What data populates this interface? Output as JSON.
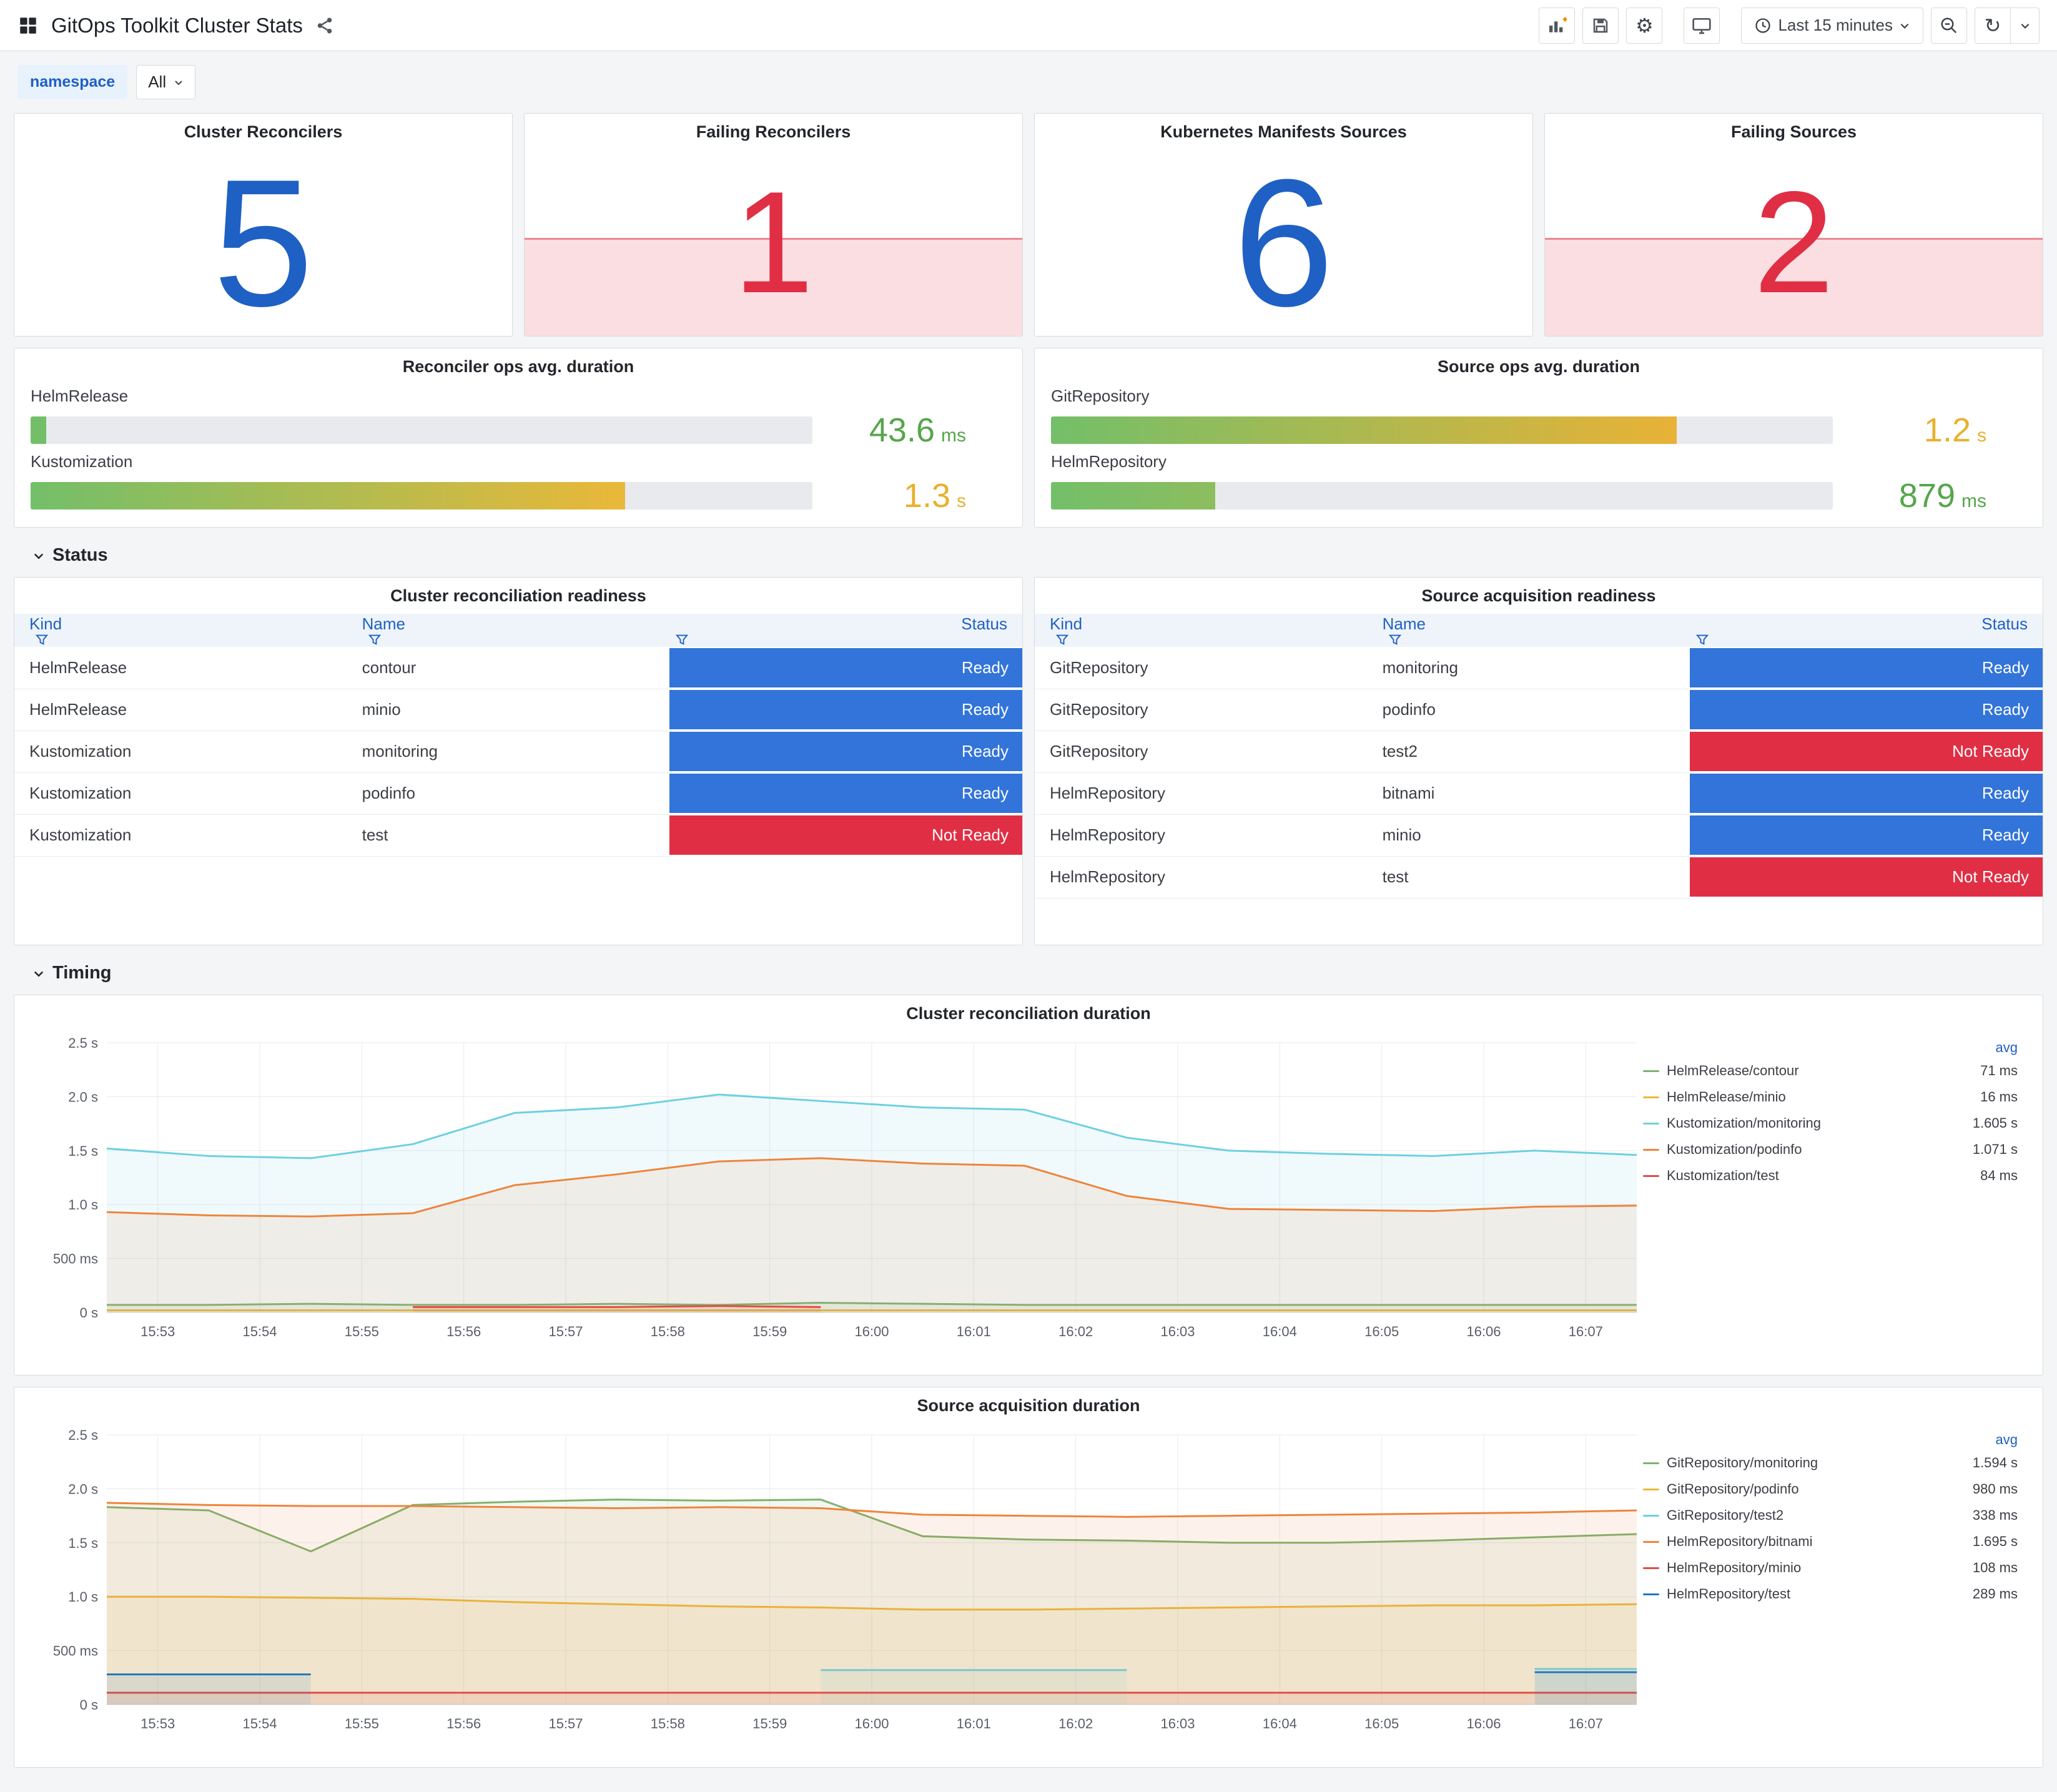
{
  "toolbar": {
    "title": "GitOps Toolkit Cluster Stats",
    "time_range": "Last 15 minutes"
  },
  "icons": {
    "gear": "⚙",
    "refresh": "↻"
  },
  "variables": {
    "namespace_label": "namespace",
    "namespace_value": "All"
  },
  "sections": {
    "status": "Status",
    "timing": "Timing"
  },
  "colors": {
    "blue": "#1F60C4",
    "red": "#E02F44",
    "ready": "#3274D9",
    "not_ready": "#E02F44",
    "alert_band": "rgba(224,47,68,0.16)",
    "alert_line": "rgba(224,47,68,0.5)"
  },
  "stat_panels": [
    {
      "title": "Cluster Reconcilers",
      "value": "5",
      "state": "ok"
    },
    {
      "title": "Failing Reconcilers",
      "value": "1",
      "state": "alert"
    },
    {
      "title": "Kubernetes Manifests Sources",
      "value": "6",
      "state": "ok"
    },
    {
      "title": "Failing Sources",
      "value": "2",
      "state": "alert"
    }
  ],
  "gauge_panels": [
    {
      "title": "Reconciler ops avg. duration",
      "rows": [
        {
          "label": "HelmRelease",
          "value": "43.6",
          "unit": "ms",
          "pct": 2,
          "value_color": "#56A64B",
          "bar_from": "#73BF69",
          "bar_to": "#73BF69"
        },
        {
          "label": "Kustomization",
          "value": "1.3",
          "unit": "s",
          "pct": 76,
          "value_color": "#E8B12E",
          "bar_from": "#73BF69",
          "bar_to": "#EAB839"
        }
      ]
    },
    {
      "title": "Source ops avg. duration",
      "rows": [
        {
          "label": "GitRepository",
          "value": "1.2",
          "unit": "s",
          "pct": 80,
          "value_color": "#E8B12E",
          "bar_from": "#73BF69",
          "bar_to": "#E8B236"
        },
        {
          "label": "HelmRepository",
          "value": "879",
          "unit": "ms",
          "pct": 21,
          "value_color": "#56A64B",
          "bar_from": "#73BF69",
          "bar_to": "#8CBE5F"
        }
      ]
    }
  ],
  "table_panels": [
    {
      "title": "Cluster reconciliation readiness",
      "columns": [
        "Kind",
        "Name",
        "Status"
      ],
      "rows": [
        [
          "HelmRelease",
          "contour",
          "Ready"
        ],
        [
          "HelmRelease",
          "minio",
          "Ready"
        ],
        [
          "Kustomization",
          "monitoring",
          "Ready"
        ],
        [
          "Kustomization",
          "podinfo",
          "Ready"
        ],
        [
          "Kustomization",
          "test",
          "Not Ready"
        ]
      ]
    },
    {
      "title": "Source acquisition readiness",
      "columns": [
        "Kind",
        "Name",
        "Status"
      ],
      "rows": [
        [
          "GitRepository",
          "monitoring",
          "Ready"
        ],
        [
          "GitRepository",
          "podinfo",
          "Ready"
        ],
        [
          "GitRepository",
          "test2",
          "Not Ready"
        ],
        [
          "HelmRepository",
          "bitnami",
          "Ready"
        ],
        [
          "HelmRepository",
          "minio",
          "Ready"
        ],
        [
          "HelmRepository",
          "test",
          "Not Ready"
        ]
      ]
    }
  ],
  "chart_data": [
    {
      "type": "line",
      "title": "Cluster reconciliation duration",
      "ylim": [
        0,
        2.5
      ],
      "yticks": [
        {
          "v": 0,
          "label": "0 s"
        },
        {
          "v": 0.5,
          "label": "500 ms"
        },
        {
          "v": 1,
          "label": "1.0 s"
        },
        {
          "v": 1.5,
          "label": "1.5 s"
        },
        {
          "v": 2,
          "label": "2.0 s"
        },
        {
          "v": 2.5,
          "label": "2.5 s"
        }
      ],
      "x_domain": [
        0,
        15
      ],
      "tick_start": 0.5,
      "xticks": [
        "15:53",
        "15:54",
        "15:55",
        "15:56",
        "15:57",
        "15:58",
        "15:59",
        "16:00",
        "16:01",
        "16:02",
        "16:03",
        "16:04",
        "16:05",
        "16:06",
        "16:07"
      ],
      "legend_header": "avg",
      "series": [
        {
          "name": "HelmRelease/contour",
          "avg": "71 ms",
          "color": "#7EB26D",
          "values": [
            0.07,
            0.07,
            0.08,
            0.07,
            0.07,
            0.08,
            0.07,
            0.09,
            0.08,
            0.07,
            0.07,
            0.07,
            0.07,
            0.07,
            0.07,
            0.07
          ]
        },
        {
          "name": "HelmRelease/minio",
          "avg": "16 ms",
          "color": "#EAB839",
          "values": [
            0.02,
            0.02,
            0.02,
            0.02,
            0.02,
            0.02,
            0.02,
            0.02,
            0.02,
            0.02,
            0.02,
            0.02,
            0.02,
            0.02,
            0.02,
            0.02
          ]
        },
        {
          "name": "Kustomization/monitoring",
          "avg": "1.605 s",
          "color": "#6ED0E0",
          "values": [
            1.52,
            1.45,
            1.43,
            1.56,
            1.85,
            1.9,
            2.02,
            1.96,
            1.9,
            1.88,
            1.62,
            1.5,
            1.47,
            1.45,
            1.5,
            1.46
          ]
        },
        {
          "name": "Kustomization/podinfo",
          "avg": "1.071 s",
          "color": "#EF843C",
          "values": [
            0.93,
            0.9,
            0.89,
            0.92,
            1.18,
            1.28,
            1.4,
            1.43,
            1.38,
            1.36,
            1.08,
            0.96,
            0.95,
            0.94,
            0.98,
            0.99
          ]
        },
        {
          "name": "Kustomization/test",
          "avg": "84 ms",
          "color": "#E24D42",
          "values": [
            null,
            null,
            null,
            0.05,
            0.05,
            0.05,
            0.06,
            0.05,
            null,
            null,
            null,
            null,
            null,
            null,
            null,
            null
          ]
        }
      ]
    },
    {
      "type": "line",
      "title": "Source acquisition duration",
      "ylim": [
        0,
        2.5
      ],
      "yticks": [
        {
          "v": 0,
          "label": "0 s"
        },
        {
          "v": 0.5,
          "label": "500 ms"
        },
        {
          "v": 1,
          "label": "1.0 s"
        },
        {
          "v": 1.5,
          "label": "1.5 s"
        },
        {
          "v": 2,
          "label": "2.0 s"
        },
        {
          "v": 2.5,
          "label": "2.5 s"
        }
      ],
      "x_domain": [
        0,
        15
      ],
      "tick_start": 0.5,
      "xticks": [
        "15:53",
        "15:54",
        "15:55",
        "15:56",
        "15:57",
        "15:58",
        "15:59",
        "16:00",
        "16:01",
        "16:02",
        "16:03",
        "16:04",
        "16:05",
        "16:06",
        "16:07"
      ],
      "legend_header": "avg",
      "series": [
        {
          "name": "GitRepository/monitoring",
          "avg": "1.594 s",
          "color": "#7EB26D",
          "values": [
            1.83,
            1.8,
            1.42,
            1.85,
            1.88,
            1.9,
            1.89,
            1.9,
            1.56,
            1.53,
            1.52,
            1.5,
            1.5,
            1.52,
            1.55,
            1.58
          ]
        },
        {
          "name": "GitRepository/podinfo",
          "avg": "980 ms",
          "color": "#EAB839",
          "values": [
            1.0,
            1.0,
            0.99,
            0.98,
            0.95,
            0.93,
            0.91,
            0.9,
            0.88,
            0.88,
            0.89,
            0.9,
            0.91,
            0.92,
            0.92,
            0.93
          ]
        },
        {
          "name": "GitRepository/test2",
          "avg": "338 ms",
          "color": "#6ED0E0",
          "values": [
            null,
            null,
            null,
            null,
            null,
            null,
            null,
            0.32,
            0.32,
            0.32,
            0.32,
            null,
            null,
            null,
            0.33,
            0.33
          ]
        },
        {
          "name": "HelmRepository/bitnami",
          "avg": "1.695 s",
          "color": "#EF843C",
          "values": [
            1.87,
            1.85,
            1.84,
            1.84,
            1.83,
            1.82,
            1.83,
            1.82,
            1.76,
            1.75,
            1.74,
            1.75,
            1.76,
            1.77,
            1.78,
            1.8
          ]
        },
        {
          "name": "HelmRepository/minio",
          "avg": "108 ms",
          "color": "#E24D42",
          "values": [
            0.11,
            0.11,
            0.11,
            0.11,
            0.11,
            0.11,
            0.11,
            0.11,
            0.11,
            0.11,
            0.11,
            0.11,
            0.11,
            0.11,
            0.11,
            0.11
          ]
        },
        {
          "name": "HelmRepository/test",
          "avg": "289 ms",
          "color": "#1F78C1",
          "values": [
            0.28,
            0.28,
            0.28,
            null,
            null,
            null,
            null,
            null,
            null,
            null,
            null,
            null,
            null,
            null,
            0.3,
            0.3
          ]
        }
      ]
    }
  ]
}
